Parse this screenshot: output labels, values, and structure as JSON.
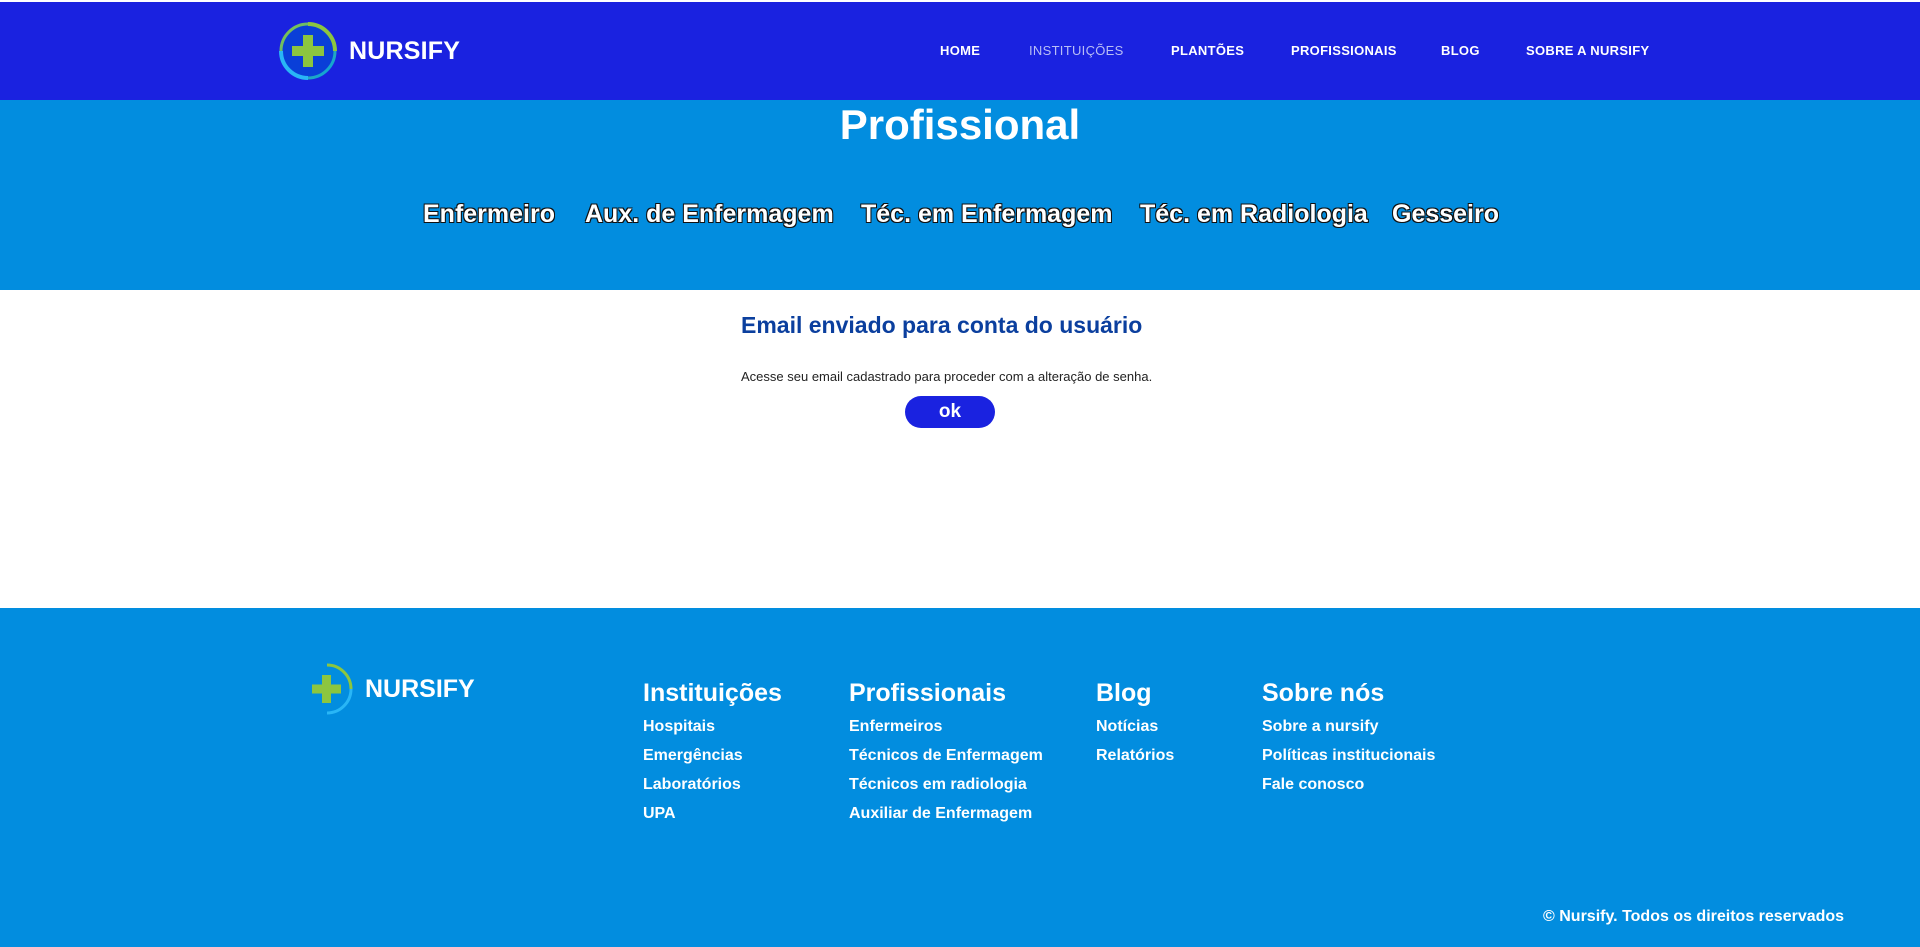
{
  "brand": {
    "name": "NURSIFY",
    "color_primary": "#1a22e0",
    "color_secondary": "#028ddf",
    "logo_cross_color": "#8cc63f"
  },
  "nav": {
    "items": [
      {
        "label": "HOME"
      },
      {
        "label": "INSTITUIÇÕES"
      },
      {
        "label": "PLANTÕES"
      },
      {
        "label": "PROFISSIONAIS"
      },
      {
        "label": "BLOG"
      },
      {
        "label": "SOBRE A NURSIFY"
      }
    ]
  },
  "hero": {
    "title": "Profissional",
    "tabs": [
      {
        "label": "Enfermeiro"
      },
      {
        "label": "Aux. de Enfermagem"
      },
      {
        "label": "Téc. em Enfermagem"
      },
      {
        "label": "Téc. em Radiologia"
      },
      {
        "label": "Gesseiro"
      }
    ]
  },
  "message": {
    "title": "Email enviado para conta do usuário",
    "text": "Acesse seu email cadastrado para proceder com a alteração de senha.",
    "button_label": "ok"
  },
  "footer": {
    "brand": "NURSIFY",
    "columns": [
      {
        "title": "Instituições",
        "links": [
          "Hospitais",
          "Emergências",
          "Laboratórios",
          "UPA"
        ]
      },
      {
        "title": "Profissionais",
        "links": [
          "Enfermeiros",
          "Técnicos de Enfermagem",
          "Técnicos em radiologia",
          "Auxiliar de Enfermagem"
        ]
      },
      {
        "title": "Blog",
        "links": [
          "Notícias",
          "Relatórios"
        ]
      },
      {
        "title": "Sobre nós",
        "links": [
          "Sobre a nursify",
          "Políticas institucionais",
          "Fale conosco"
        ]
      }
    ],
    "copyright": "© Nursify. Todos os direitos reservados"
  }
}
